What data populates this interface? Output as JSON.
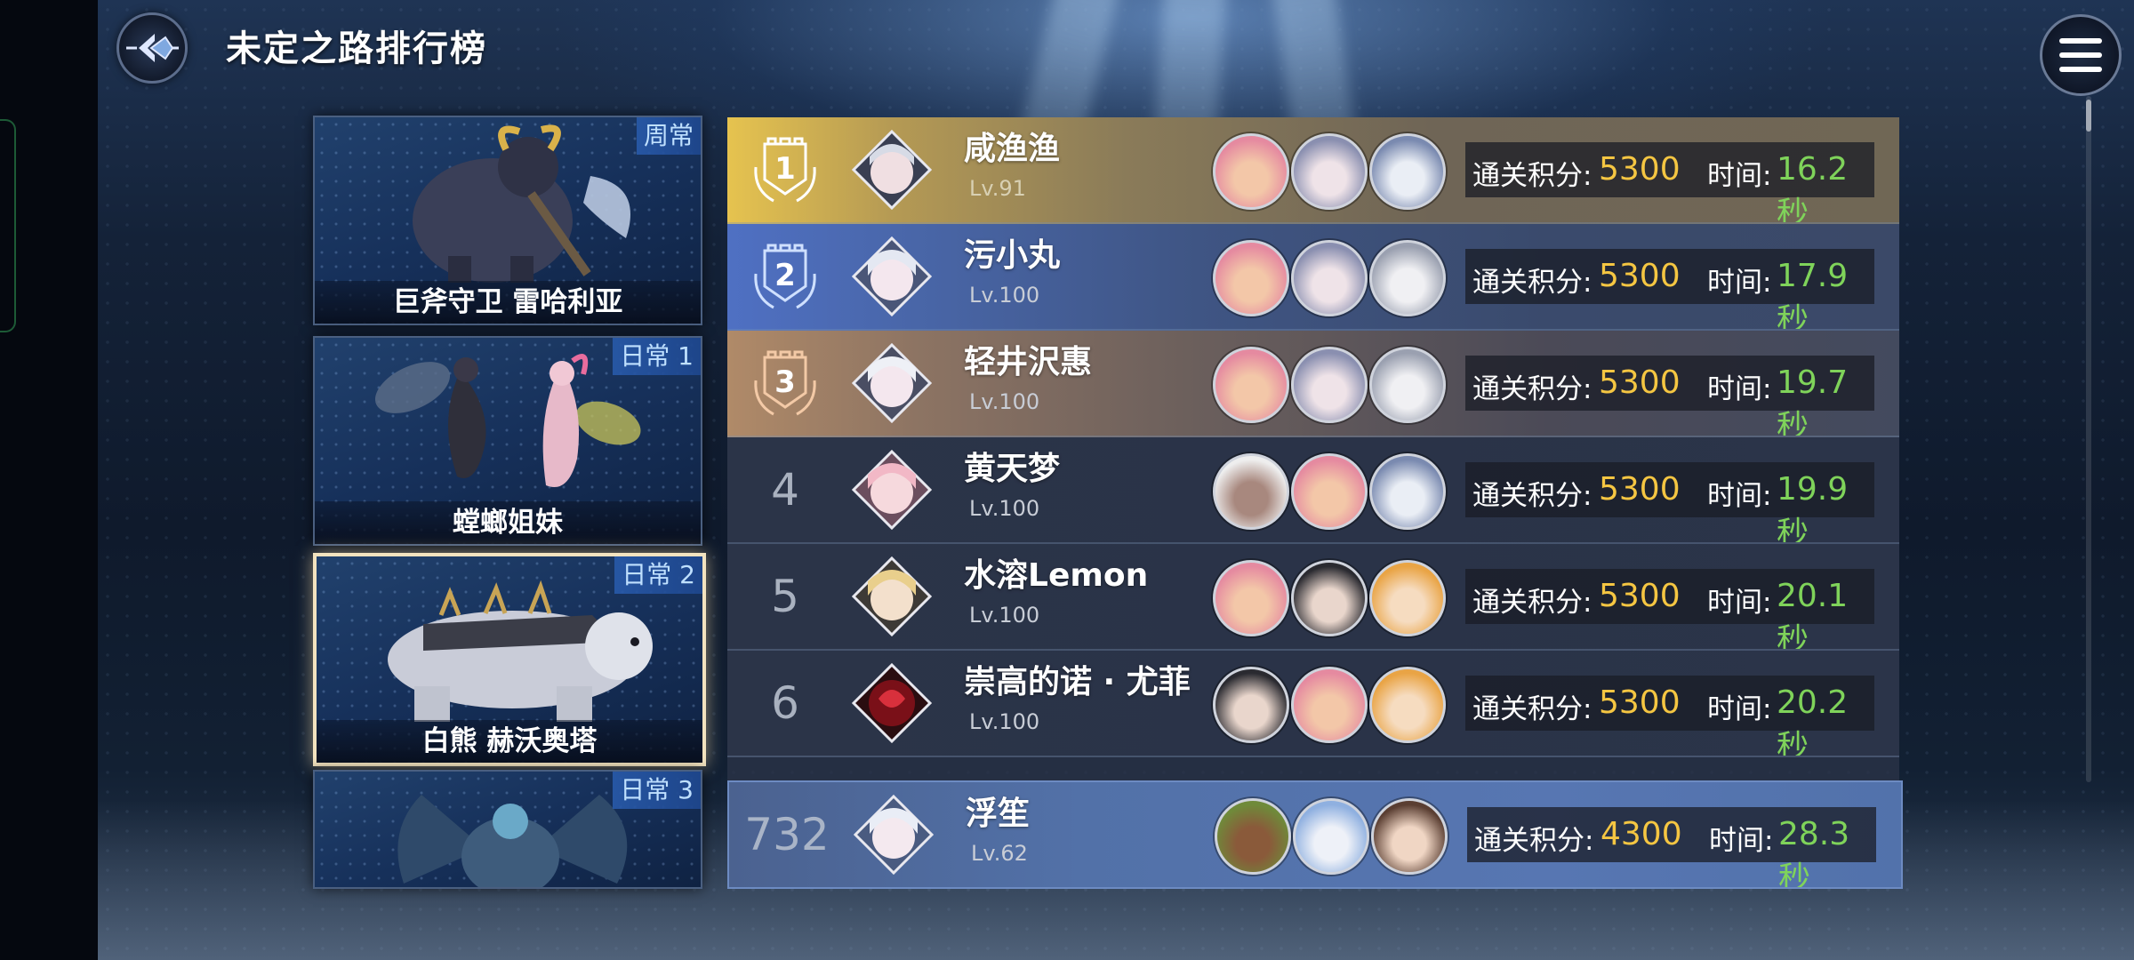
{
  "header": {
    "title": "未定之路排行榜"
  },
  "bosses": [
    {
      "tag": "周常",
      "name": "巨斧守卫 雷哈利亚",
      "selected": false
    },
    {
      "tag": "日常 1",
      "name": "螳螂姐妹",
      "selected": false
    },
    {
      "tag": "日常 2",
      "name": "白熊 赫沃奥塔",
      "selected": true
    },
    {
      "tag": "日常 3",
      "name": "",
      "selected": false
    }
  ],
  "labels": {
    "score_label": "通关积分:",
    "time_label": "时间:"
  },
  "leaderboard": [
    {
      "rank": "1",
      "name": "咸渔渔",
      "level": "Lv.91",
      "score": "5300",
      "time": "16.2秒",
      "style": "gold"
    },
    {
      "rank": "2",
      "name": "污小丸",
      "level": "Lv.100",
      "score": "5300",
      "time": "17.9秒",
      "style": "silver"
    },
    {
      "rank": "3",
      "name": "轻井沢惠",
      "level": "Lv.100",
      "score": "5300",
      "time": "19.7秒",
      "style": "bronze"
    },
    {
      "rank": "4",
      "name": "黄天梦",
      "level": "Lv.100",
      "score": "5300",
      "time": "19.9秒",
      "style": "plain"
    },
    {
      "rank": "5",
      "name": "水溶Lemon",
      "level": "Lv.100",
      "score": "5300",
      "time": "20.1秒",
      "style": "plain"
    },
    {
      "rank": "6",
      "name": "崇高的诺 · 尤菲",
      "level": "Lv.100",
      "score": "5300",
      "time": "20.2秒",
      "style": "plain"
    }
  ],
  "self_entry": {
    "rank": "732",
    "name": "浮笙",
    "level": "Lv.62",
    "score": "4300",
    "time": "28.3秒"
  },
  "icons": {
    "back": "back-arrow-icon",
    "menu": "hamburger-menu-icon"
  },
  "colors": {
    "score": "#f5c642",
    "time": "#7fd35a",
    "gold_row": "#e6c34f",
    "silver_row": "#4f70c3",
    "bronze_row": "#b08a68",
    "self_row": "#5776b2"
  }
}
